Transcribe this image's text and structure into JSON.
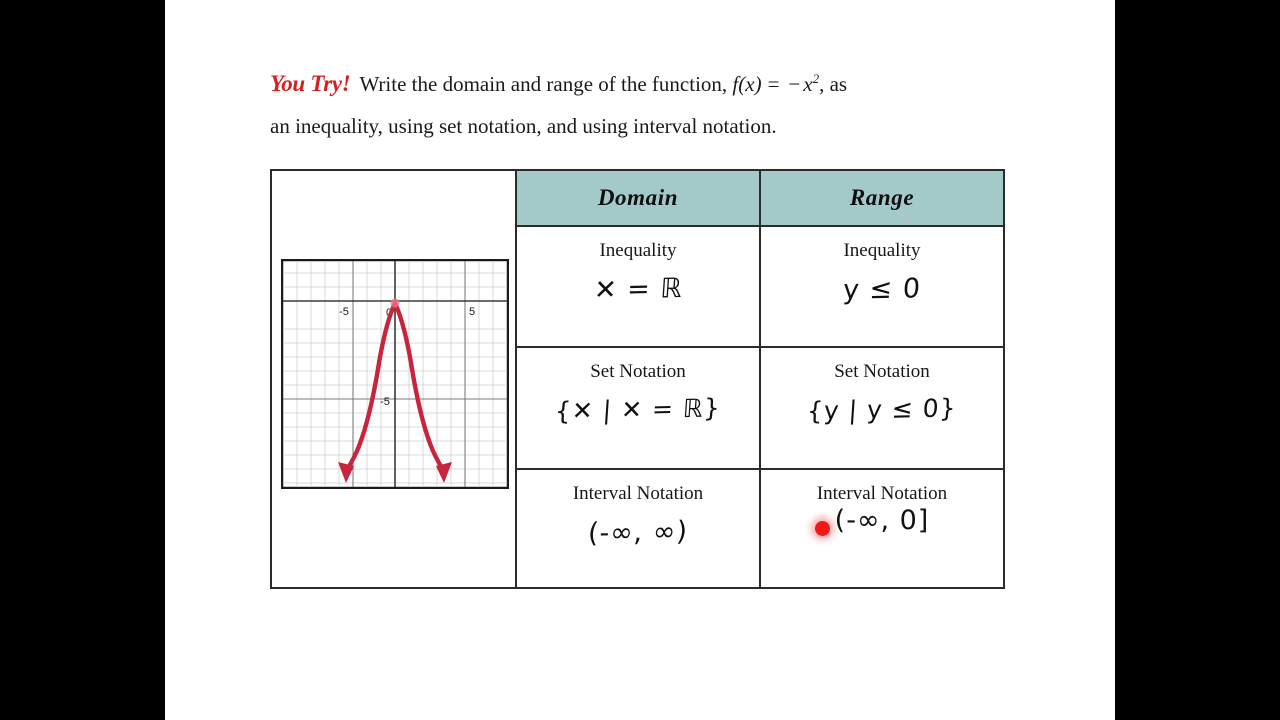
{
  "prompt": {
    "tag": "You Try!",
    "line1_a": "Write the domain and range of the function,",
    "fn_name": "f",
    "fn_arg": "(x)",
    "equals": "=",
    "minus": "−",
    "var": "x",
    "exp": "2",
    "line1_b": ", as",
    "line2": "an inequality, using set notation, and using interval notation."
  },
  "table": {
    "headers": {
      "domain": "Domain",
      "range": "Range"
    },
    "rows": [
      {
        "title": "Inequality",
        "domain_answer": "✕ = ℝ",
        "range_answer": "y ≤ 0"
      },
      {
        "title": "Set Notation",
        "domain_answer": "{✕ | ✕ = ℝ}",
        "range_answer": "{y | y ≤ 0}"
      },
      {
        "title": "Interval Notation",
        "domain_answer": "(-∞, ∞)",
        "range_answer": "(-∞, 0]"
      }
    ]
  },
  "chart_data": {
    "type": "line",
    "title": "",
    "xlabel": "",
    "ylabel": "",
    "function": "f(x) = -x^2",
    "xlim": [
      -8,
      8
    ],
    "ylim": [
      -13,
      3
    ],
    "grid": true,
    "legend": false,
    "curve_color": "#c8243c",
    "x_tick_labels": [
      "-5",
      "0",
      "5"
    ],
    "x_tick_values": [
      -5,
      0,
      5
    ],
    "y_tick_labels": [
      "-5"
    ],
    "y_tick_values": [
      -5
    ],
    "arrowheads": [
      "down-left-end",
      "down-right-end"
    ],
    "vertex": [
      0,
      0
    ],
    "series": [
      {
        "name": "f(x) = -x^2",
        "x": [
          -3.4,
          -3.0,
          -2.5,
          -2.0,
          -1.5,
          -1.0,
          -0.5,
          0,
          0.5,
          1.0,
          1.5,
          2.0,
          2.5,
          3.0,
          3.4
        ],
        "y": [
          -11.56,
          -9.0,
          -6.25,
          -4.0,
          -2.25,
          -1.0,
          -0.25,
          0,
          -0.25,
          -1.0,
          -2.25,
          -4.0,
          -6.25,
          -9.0,
          -11.56
        ]
      }
    ]
  }
}
